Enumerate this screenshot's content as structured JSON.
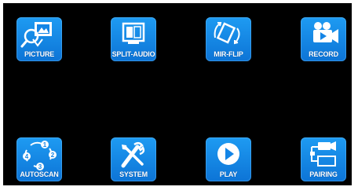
{
  "menu": {
    "items": [
      {
        "label": "PICTURE",
        "icon": "picture-icon"
      },
      {
        "label": "SPLIT-AUDIO",
        "icon": "split-screen-icon"
      },
      {
        "label": "MIR-FLIP",
        "icon": "mirror-flip-icon"
      },
      {
        "label": "RECORD",
        "icon": "video-camera-icon"
      },
      {
        "label": "AUTOSCAN",
        "icon": "autoscan-cycle-icon"
      },
      {
        "label": "SYSTEM",
        "icon": "tools-icon"
      },
      {
        "label": "PLAY",
        "icon": "play-icon"
      },
      {
        "label": "PAIRING",
        "icon": "pairing-camera-icon"
      }
    ]
  },
  "colors": {
    "background": "#000000",
    "tile_blue": "#1485e6",
    "label": "#ffffff"
  }
}
